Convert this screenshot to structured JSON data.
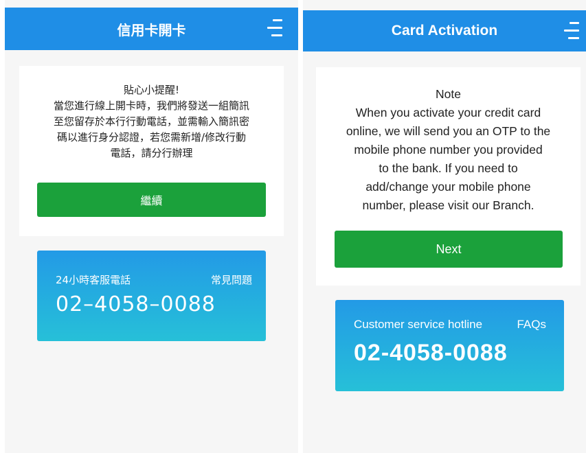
{
  "zh": {
    "header": {
      "title": "信用卡開卡",
      "menu_icon": "hamburger-menu-icon"
    },
    "notice": {
      "text": "貼心小提醒!\n當您進行線上開卡時，我們將發送一組簡訊\n至您留存於本行行動電話，並需輸入簡訊密\n碼以進行身分認證，若您需新增/修改行動\n電話，請分行辦理"
    },
    "continue_label": "繼續",
    "hotline": {
      "label": "24小時客服電話",
      "faq": "常見問題",
      "number": "02–4058–0088"
    }
  },
  "en": {
    "header": {
      "title": "Card Activation",
      "menu_icon": "hamburger-menu-icon"
    },
    "notice": {
      "text": "Note\nWhen you activate your credit card\nonline, we will send you an OTP to the\nmobile phone number you provided\nto the bank. If you need to\nadd/change your mobile phone\nnumber, please visit our Branch."
    },
    "next_label": "Next",
    "hotline": {
      "label": "Customer service hotline",
      "faq": "FAQs",
      "number": "02-4058-0088"
    }
  },
  "colors": {
    "header": "#1f8ee6",
    "button": "#1ba13b",
    "hotline_top": "#239ae6",
    "hotline_bottom": "#26c0d8",
    "background": "#f6f6f6"
  }
}
